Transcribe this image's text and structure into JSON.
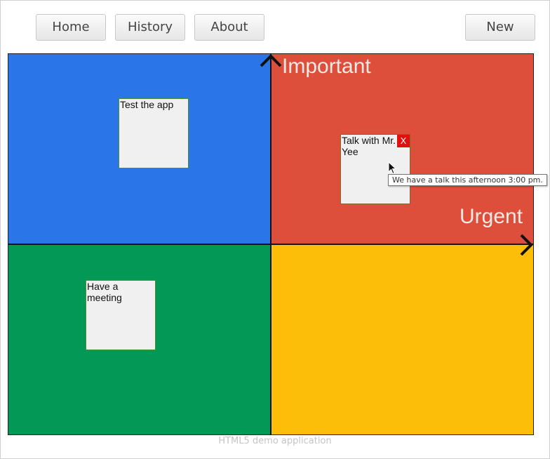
{
  "nav": {
    "home_label": "Home",
    "history_label": "History",
    "about_label": "About",
    "new_label": "New"
  },
  "board": {
    "axis_important": "Important",
    "axis_urgent": "Urgent",
    "colors": {
      "top_left": "#2a76e8",
      "top_right": "#dd4e3b",
      "bottom_left": "#049856",
      "bottom_right": "#fdbe0a"
    }
  },
  "notes": [
    {
      "text": "Test the app",
      "quadrant": "top-left",
      "has_close": false
    },
    {
      "text": "Talk with Mr. Yee",
      "quadrant": "top-right",
      "has_close": true,
      "close_label": "X"
    },
    {
      "text": "Have a meeting",
      "quadrant": "bottom-left",
      "has_close": false
    }
  ],
  "tooltip": {
    "text": "We have a talk this afternoon 3:00 pm."
  },
  "footer": {
    "text": "HTML5 demo application"
  },
  "icons": {
    "up_arrow": "chevron-up-icon",
    "right_arrow": "chevron-right-icon",
    "cursor": "mouse-pointer-icon"
  }
}
